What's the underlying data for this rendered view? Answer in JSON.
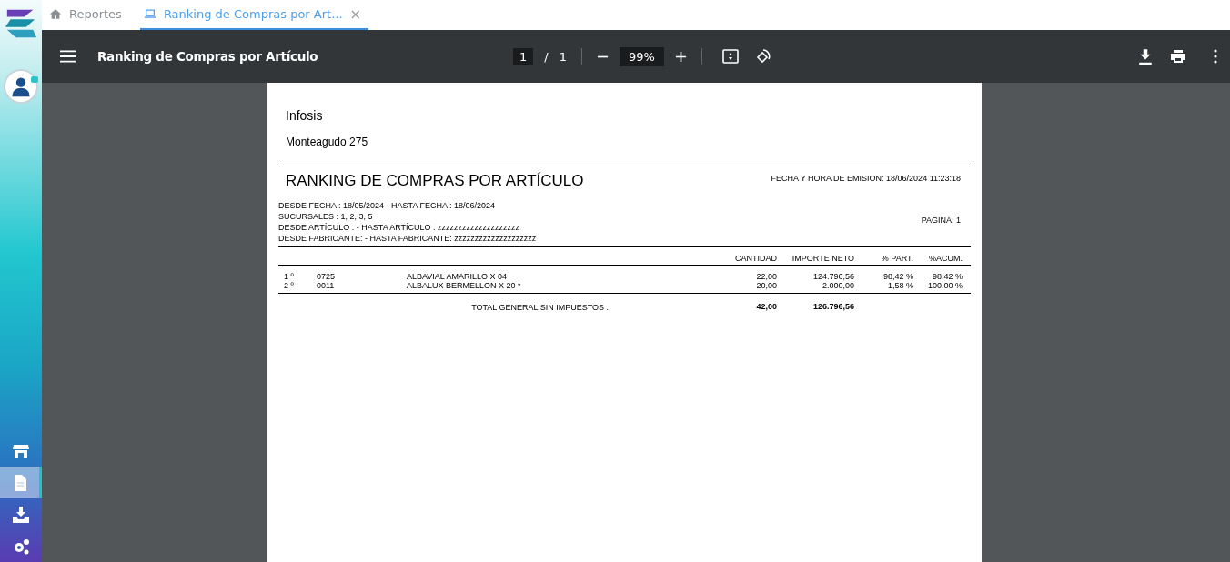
{
  "sidebar": {
    "items": [
      {
        "selected": false
      },
      {
        "selected": true
      },
      {
        "selected": false
      },
      {
        "selected": false
      }
    ]
  },
  "tabs": [
    {
      "label": "Reportes",
      "selected": false
    },
    {
      "label": "Ranking de Compras por Art...",
      "close": "×",
      "selected": true
    }
  ],
  "toolbar": {
    "title": "Ranking de Compras por Artículo",
    "page": "1",
    "page_separator": "/",
    "page_count": "1",
    "zoom": "99%"
  },
  "report": {
    "company": "Infosis",
    "address": "Monteagudo 275",
    "title": "RANKING DE COMPRAS POR ARTÍCULO",
    "emission": "FECHA Y HORA DE EMISION: 18/06/2024 11:23:18",
    "filters": [
      "DESDE FECHA : 18/05/2024 - HASTA FECHA : 18/06/2024",
      "SUCURSALES : 1, 2, 3, 5",
      "DESDE ARTÍCULO :  - HASTA ARTÍCULO : zzzzzzzzzzzzzzzzzzzz",
      "DESDE FABRICANTE:  - HASTA FABRICANTE: zzzzzzzzzzzzzzzzzzzz"
    ],
    "page_label": "PAGINA: 1",
    "columns": [
      "CANTIDAD",
      "IMPORTE NETO",
      "% PART.",
      "%ACUM."
    ],
    "rows": [
      {
        "rank": "1 º",
        "code": "0725",
        "description": "ALBAVIAL AMARILLO X 04",
        "quantity": "22,00",
        "amount": "124.796,56",
        "part": "98,42 %",
        "accum": "98,42 %"
      },
      {
        "rank": "2 º",
        "code": "0011",
        "description": "ALBALUX BERMELLON X 20  *",
        "quantity": "20,00",
        "amount": "2.000,00",
        "part": "1,58 %",
        "accum": "100,00 %"
      }
    ],
    "total": {
      "label": "TOTAL GENERAL SIN IMPUESTOS :",
      "quantity": "42,00",
      "amount": "126.796,56"
    }
  }
}
